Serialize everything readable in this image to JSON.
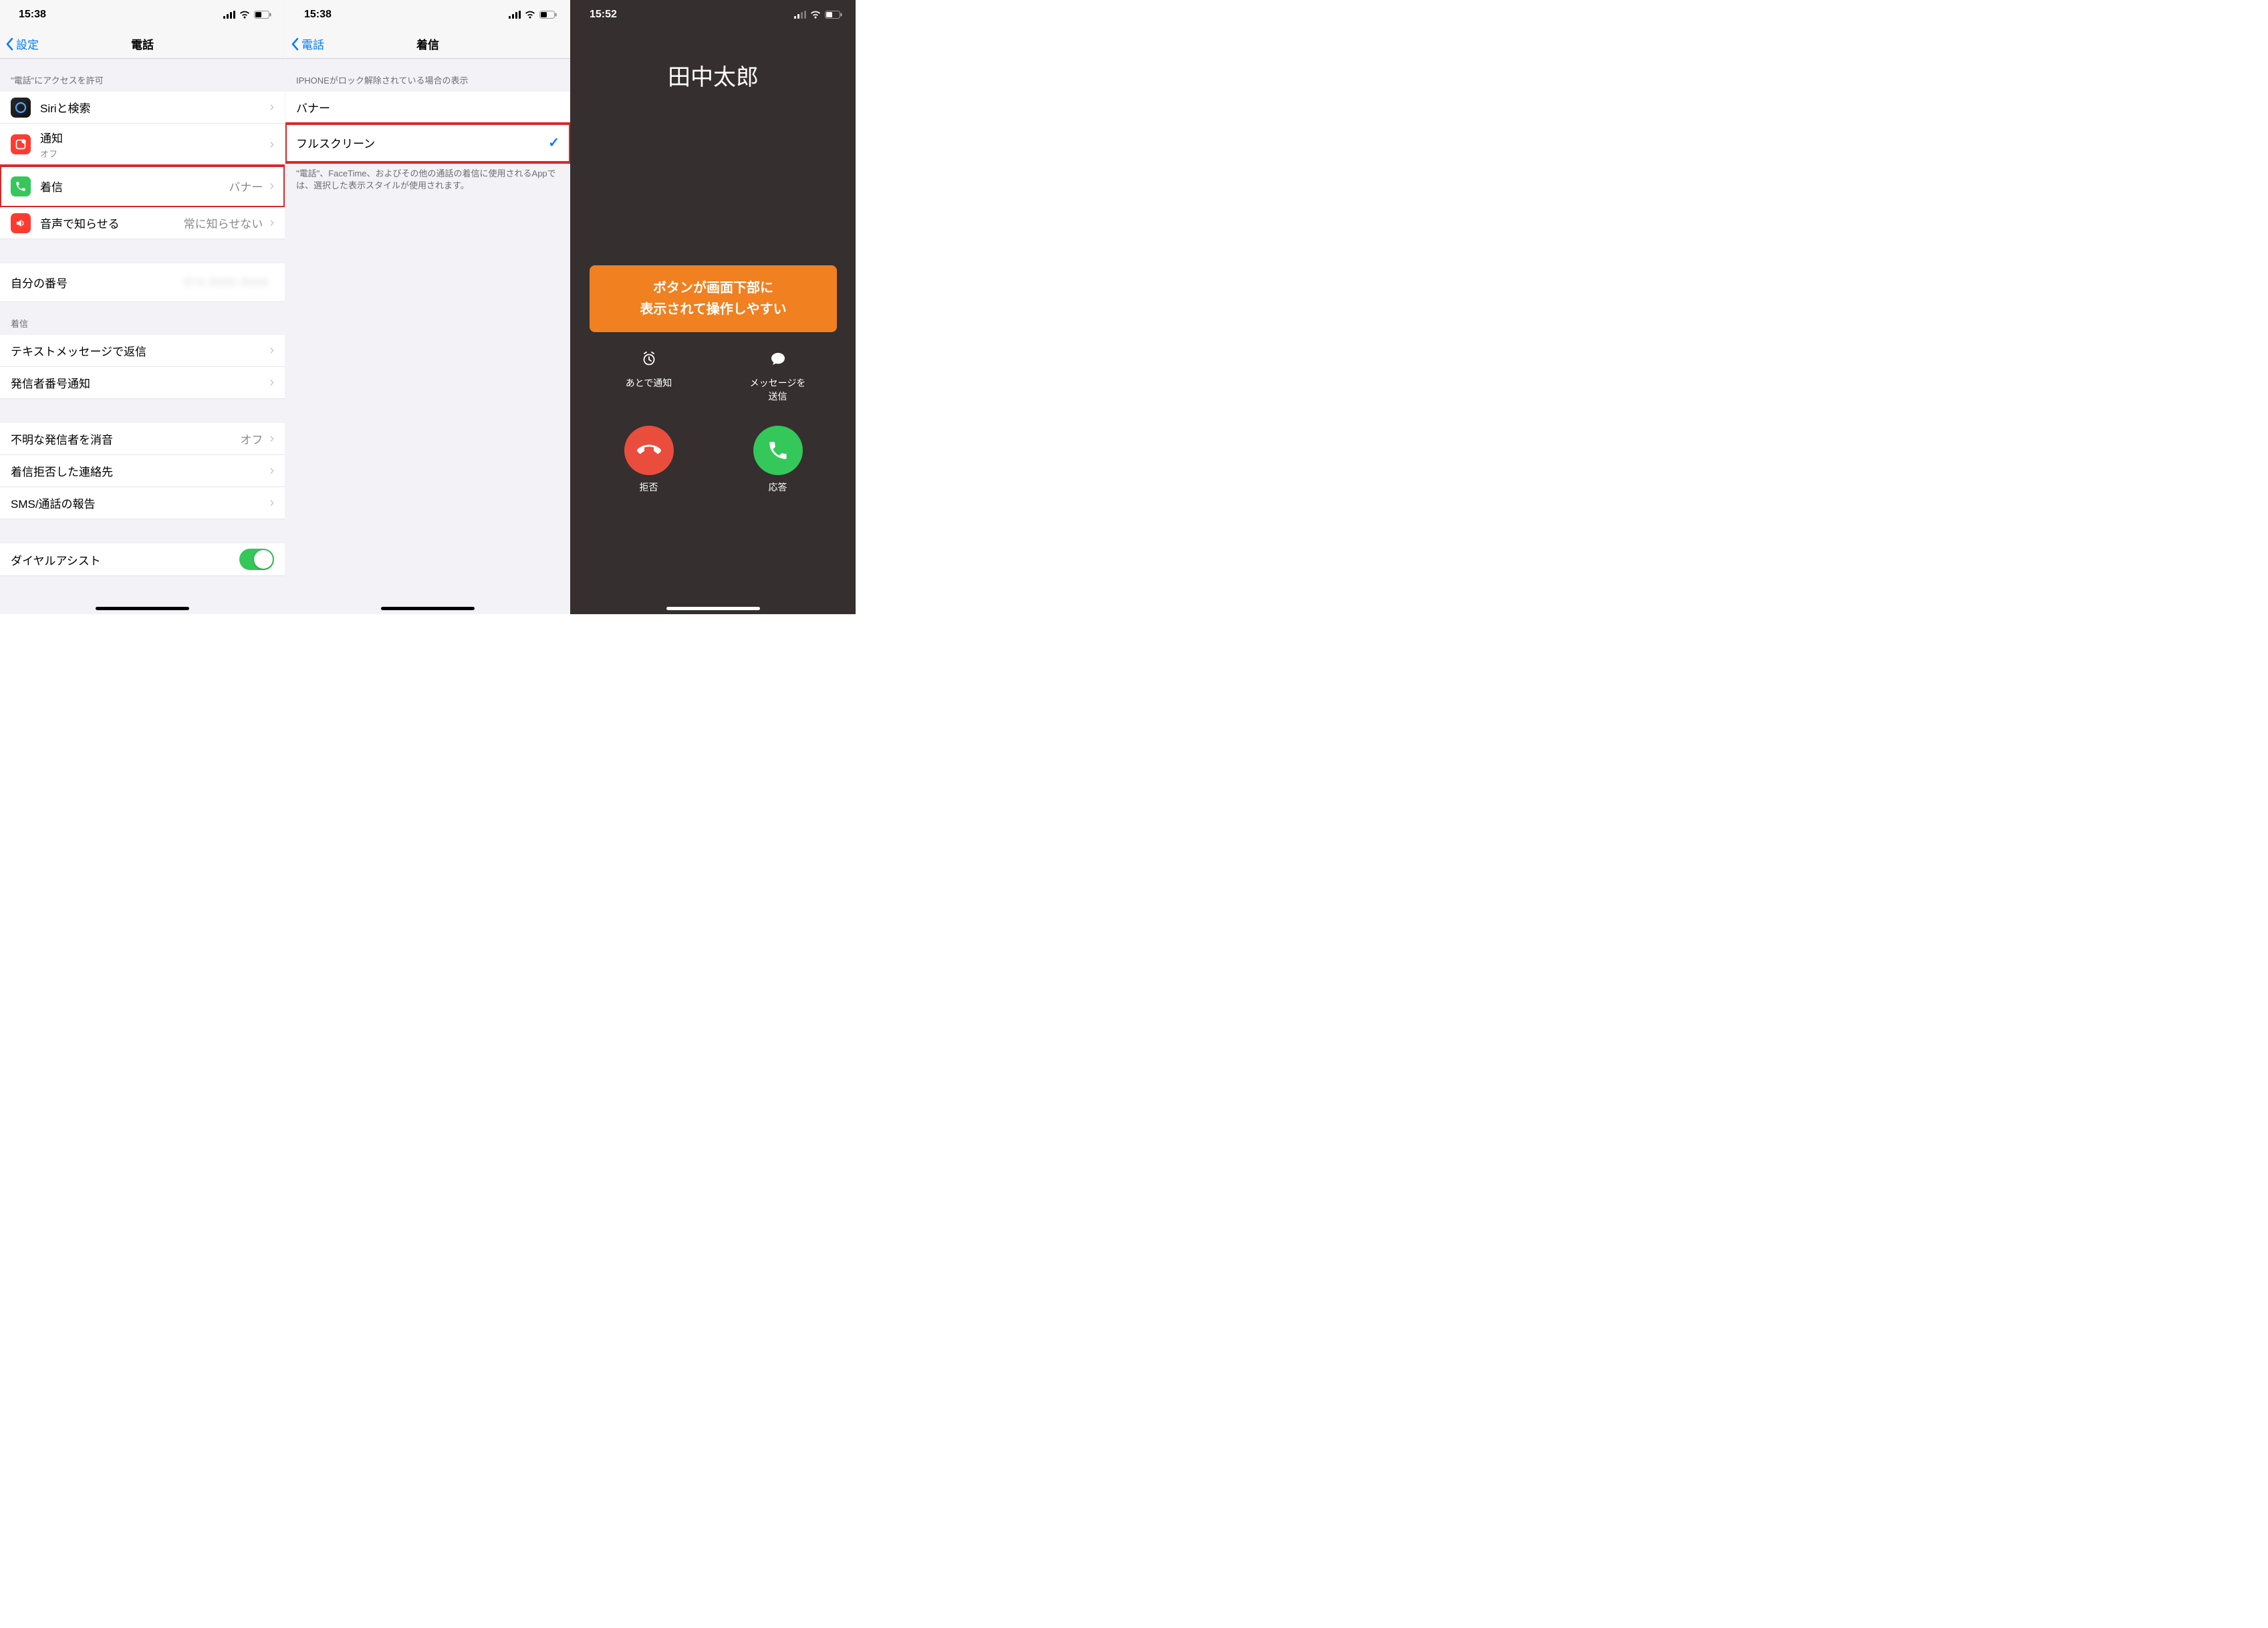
{
  "screen1": {
    "status_time": "15:38",
    "back_label": "設定",
    "title": "電話",
    "section_allow_header": "\"電話\"にアクセスを許可",
    "rows": {
      "siri": {
        "label": "Siriと検索"
      },
      "notifications": {
        "label": "通知",
        "sublabel": "オフ"
      },
      "incoming": {
        "label": "着信",
        "value": "バナー"
      },
      "announce": {
        "label": "音声で知らせる",
        "value": "常に知らせない"
      },
      "my_number": {
        "label": "自分の番号",
        "value_hidden": "070 0000 0000"
      }
    },
    "section_incoming_header": "着信",
    "rows2": {
      "text_reply": {
        "label": "テキストメッセージで返信"
      },
      "caller_id": {
        "label": "発信者番号通知"
      }
    },
    "rows3": {
      "silence_unknown": {
        "label": "不明な発信者を消音",
        "value": "オフ"
      },
      "blocked": {
        "label": "着信拒否した連絡先"
      },
      "report": {
        "label": "SMS/通話の報告"
      }
    },
    "rows4": {
      "dial_assist": {
        "label": "ダイヤルアシスト"
      }
    }
  },
  "screen2": {
    "status_time": "15:38",
    "back_label": "電話",
    "title": "着信",
    "section_header": "IPHONEがロック解除されている場合の表示",
    "option_banner": "バナー",
    "option_fullscreen": "フルスクリーン",
    "footer": "\"電話\"、FaceTime、およびその他の通話の着信に使用されるAppでは、選択した表示スタイルが使用されます。"
  },
  "screen3": {
    "status_time": "15:52",
    "caller": "田中太郎",
    "callout_line1": "ボタンが画面下部に",
    "callout_line2": "表示されて操作しやすい",
    "remind_label": "あとで通知",
    "message_label": "メッセージを\n送信",
    "decline_label": "拒否",
    "accept_label": "応答"
  },
  "colors": {
    "siri_icon_bg": "#1c1c1e",
    "notif_icon_bg": "#ff3b30",
    "incoming_icon_bg": "#34c759",
    "announce_icon_bg": "#ff3b30"
  }
}
